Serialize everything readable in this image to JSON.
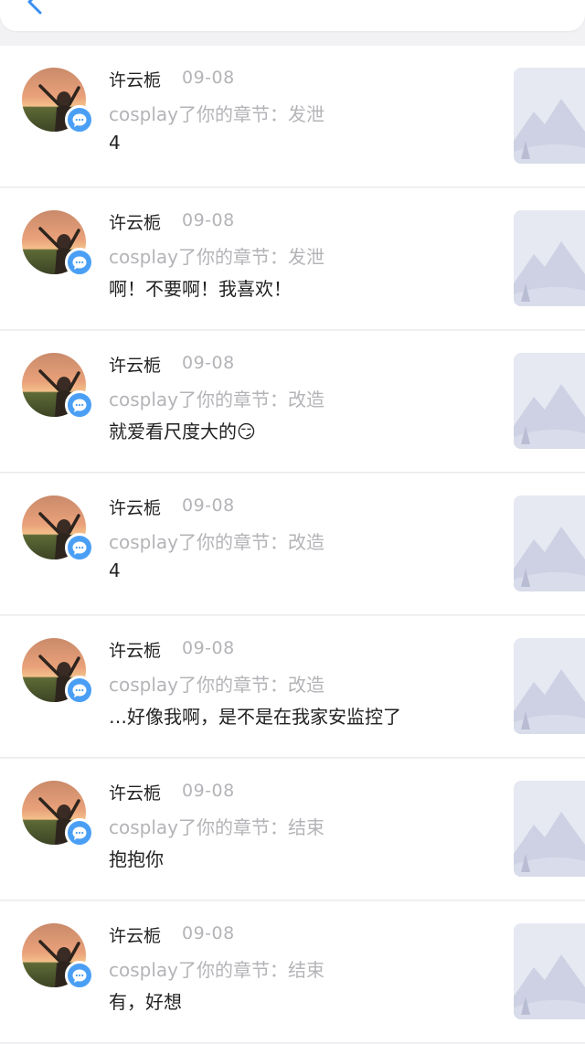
{
  "header": {
    "back_icon": "chevron-left-icon"
  },
  "colors": {
    "accent": "#4a9ff5",
    "muted": "#b4b4b8",
    "text": "#222222"
  },
  "notifications": [
    {
      "user": "许云栀",
      "date": "09-08",
      "action": "cosplay了你的章节：发泄",
      "content": "4"
    },
    {
      "user": "许云栀",
      "date": "09-08",
      "action": "cosplay了你的章节：发泄",
      "content": "啊！不要啊！我喜欢！"
    },
    {
      "user": "许云栀",
      "date": "09-08",
      "action": "cosplay了你的章节：改造",
      "content": "就爱看尺度大的😏"
    },
    {
      "user": "许云栀",
      "date": "09-08",
      "action": "cosplay了你的章节：改造",
      "content": "4"
    },
    {
      "user": "许云栀",
      "date": "09-08",
      "action": "cosplay了你的章节：改造",
      "content": "…好像我啊，是不是在我家安监控了"
    },
    {
      "user": "许云栀",
      "date": "09-08",
      "action": "cosplay了你的章节：结束",
      "content": "抱抱你"
    },
    {
      "user": "许云栀",
      "date": "09-08",
      "action": "cosplay了你的章节：结束",
      "content": "有，好想"
    }
  ]
}
